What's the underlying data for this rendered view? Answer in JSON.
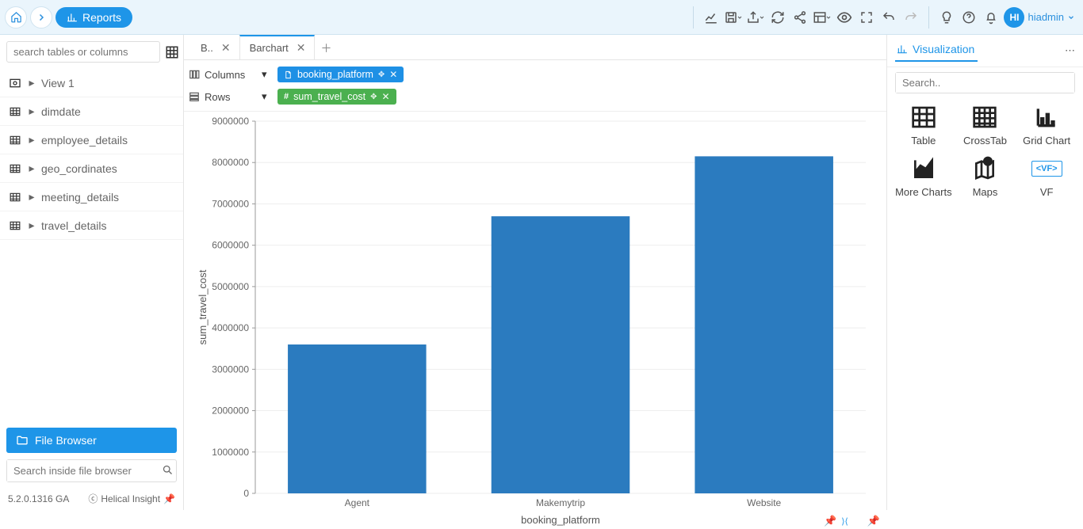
{
  "topbar": {
    "reports_label": "Reports",
    "username": "hiadmin",
    "avatar": "HI"
  },
  "sidebar": {
    "search_placeholder": "search tables or columns",
    "items": [
      {
        "label": "View 1",
        "icon": "view"
      },
      {
        "label": "dimdate",
        "icon": "table"
      },
      {
        "label": "employee_details",
        "icon": "table"
      },
      {
        "label": "geo_cordinates",
        "icon": "table"
      },
      {
        "label": "meeting_details",
        "icon": "table"
      },
      {
        "label": "travel_details",
        "icon": "table"
      }
    ],
    "file_browser_label": "File Browser",
    "fb_search_placeholder": "Search inside file browser",
    "version": "5.2.0.1316 GA",
    "brand": "Helical Insight"
  },
  "tabs": [
    {
      "label": "B..",
      "active": false
    },
    {
      "label": "Barchart",
      "active": true
    }
  ],
  "shelves": {
    "columns_label": "Columns",
    "rows_label": "Rows",
    "column_pill": "booking_platform",
    "row_pill": "sum_travel_cost"
  },
  "right": {
    "tab_label": "Visualization",
    "search_placeholder": "Search..",
    "viz": [
      {
        "label": "Table"
      },
      {
        "label": "CrossTab"
      },
      {
        "label": "Grid Chart"
      },
      {
        "label": "More Charts"
      },
      {
        "label": "Maps"
      },
      {
        "label": "VF"
      }
    ]
  },
  "chart_data": {
    "type": "bar",
    "categories": [
      "Agent",
      "Makemytrip",
      "Website"
    ],
    "values": [
      3600000,
      6700000,
      8150000
    ],
    "xlabel": "booking_platform",
    "ylabel": "sum_travel_cost",
    "ylim": [
      0,
      9000000
    ],
    "yticks": [
      0,
      1000000,
      2000000,
      3000000,
      4000000,
      5000000,
      6000000,
      7000000,
      8000000,
      9000000
    ],
    "bar_color": "#2b7bbf"
  }
}
